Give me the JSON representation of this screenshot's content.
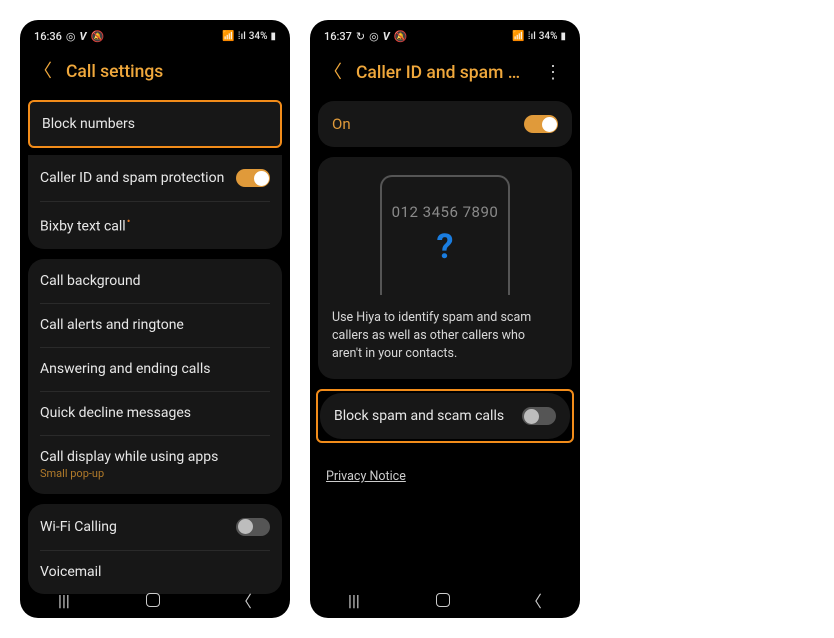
{
  "left": {
    "status": {
      "time": "16:36",
      "battery": "34%"
    },
    "header": {
      "title": "Call settings"
    },
    "group1": {
      "block_numbers": "Block numbers",
      "caller_id": "Caller ID and spam protection",
      "bixby": "Bixby text call"
    },
    "group2": {
      "call_bg": "Call background",
      "alerts": "Call alerts and ringtone",
      "answer": "Answering and ending calls",
      "decline": "Quick decline messages",
      "display_apps": "Call display while using apps",
      "display_apps_sub": "Small pop-up"
    },
    "group3": {
      "wifi": "Wi-Fi Calling",
      "voicemail": "Voicemail"
    }
  },
  "right": {
    "status": {
      "time": "16:37",
      "battery": "34%"
    },
    "header": {
      "title": "Caller ID and spam pro…"
    },
    "on_label": "On",
    "preview": {
      "number": "012 3456 7890",
      "q": "?",
      "desc": "Use Hiya to identify spam and scam callers as well as other callers who aren't in your contacts."
    },
    "block_spam": "Block spam and scam calls",
    "privacy": "Privacy Notice"
  }
}
